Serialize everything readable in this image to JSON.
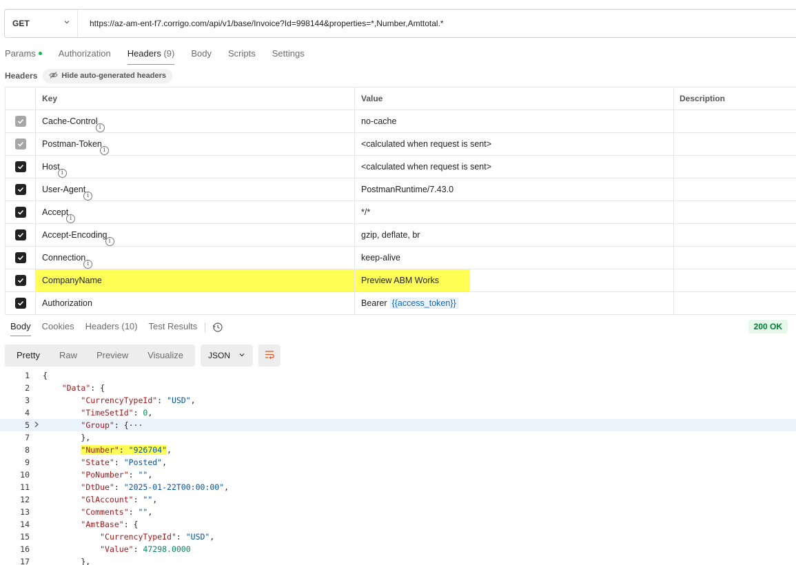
{
  "request": {
    "method": "GET",
    "url": "https://az-am-ent-f7.corrigo.com/api/v1/base/Invoice?Id=998144&properties=*,Number,Amttotal.*"
  },
  "request_tabs": {
    "params": "Params",
    "authorization": "Authorization",
    "headers": "Headers",
    "headers_count": "(9)",
    "body": "Body",
    "scripts": "Scripts",
    "settings": "Settings"
  },
  "headers_bar": {
    "label": "Headers",
    "hide_auto": "Hide auto-generated headers"
  },
  "table": {
    "col_key": "Key",
    "col_value": "Value",
    "col_desc": "Description",
    "rows": [
      {
        "key": "Cache-Control",
        "value": "no-cache",
        "checked": "gray"
      },
      {
        "key": "Postman-Token",
        "value": "<calculated when request is sent>",
        "checked": "gray"
      },
      {
        "key": "Host",
        "value": "<calculated when request is sent>",
        "checked": "dark"
      },
      {
        "key": "User-Agent",
        "value": "PostmanRuntime/7.43.0",
        "checked": "dark"
      },
      {
        "key": "Accept",
        "value": "*/*",
        "checked": "dark"
      },
      {
        "key": "Accept-Encoding",
        "value": "gzip, deflate, br",
        "checked": "dark"
      },
      {
        "key": "Connection",
        "value": "keep-alive",
        "checked": "dark"
      },
      {
        "key": "CompanyName",
        "value": "Preview ABM Works",
        "checked": "dark"
      },
      {
        "key": "Authorization",
        "value_prefix": "Bearer",
        "value_var": "{{access_token}}",
        "checked": "dark"
      }
    ]
  },
  "response_tabs": {
    "body": "Body",
    "cookies": "Cookies",
    "headers": "Headers (10)",
    "test_results": "Test Results",
    "status": "200 OK"
  },
  "response_toolbar": {
    "pretty": "Pretty",
    "raw": "Raw",
    "preview": "Preview",
    "visualize": "Visualize",
    "format": "JSON"
  },
  "code_lines": {
    "l1": "1",
    "l2": "2",
    "l3": "3",
    "l4": "4",
    "l5": "5",
    "l6": "7",
    "l7": "8",
    "l8": "9",
    "l9": "10",
    "l10": "11",
    "l11": "12",
    "l12": "13",
    "l13": "14",
    "l14": "15",
    "l15": "16",
    "l16": "17"
  },
  "json": {
    "data_key": "\"Data\"",
    "currency_key": "\"CurrencyTypeId\"",
    "currency_val": "\"USD\"",
    "timeset_key": "\"TimeSetId\"",
    "timeset_val": "0",
    "group_key": "\"Group\"",
    "number_key": "\"Number\"",
    "number_val": "\"926704\"",
    "state_key": "\"State\"",
    "state_val": "\"Posted\"",
    "ponumber_key": "\"PoNumber\"",
    "ponumber_val": "\"\"",
    "dtdue_key": "\"DtDue\"",
    "dtdue_val": "\"2025-01-22T00:00:00\"",
    "glaccount_key": "\"GlAccount\"",
    "glaccount_val": "\"\"",
    "comments_key": "\"Comments\"",
    "comments_val": "\"\"",
    "amtbase_key": "\"AmtBase\"",
    "amt_currency_key": "\"CurrencyTypeId\"",
    "amt_currency_val": "\"USD\"",
    "value_key": "\"Value\"",
    "value_val": "47298.0000"
  }
}
